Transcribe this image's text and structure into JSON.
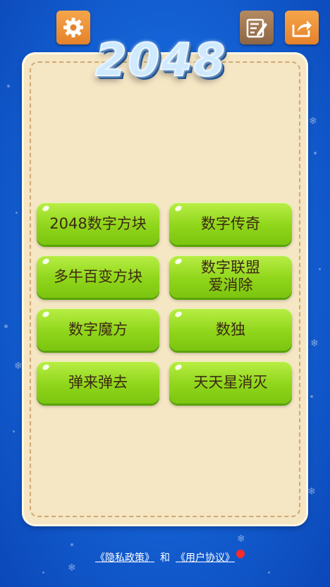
{
  "header": {
    "settings_icon": "gear-icon",
    "notes_icon": "edit-note-icon",
    "share_icon": "share-icon"
  },
  "logo": {
    "text": "2048"
  },
  "games": [
    {
      "label": "2048数字方块"
    },
    {
      "label": "数字传奇"
    },
    {
      "label": "多牛百变方块"
    },
    {
      "label": "数字联盟\n爱消除"
    },
    {
      "label": "数字魔方"
    },
    {
      "label": "数独"
    },
    {
      "label": "弹来弹去"
    },
    {
      "label": "天天星消灭"
    }
  ],
  "footer": {
    "privacy_link": "《隐私政策》",
    "and_text": "和",
    "agreement_link": "《用户协议》"
  },
  "colors": {
    "background": "#1565d8",
    "panel": "#f5e6c4",
    "button_green": "#8fd61b",
    "top_button_orange": "#e4822a",
    "top_button_brown": "#8d6644",
    "notification_red": "#ff2a2a"
  }
}
